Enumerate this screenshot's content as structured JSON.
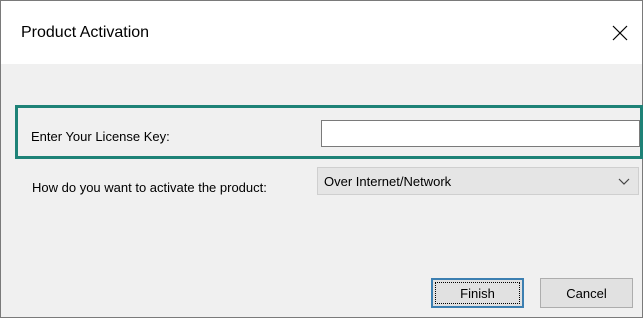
{
  "window": {
    "title": "Product Activation",
    "close_icon": "close-icon"
  },
  "form": {
    "license_label": "Enter Your License Key:",
    "license_value": "",
    "activation_label": "How do you want to activate the product:",
    "activation_selected": "Over Internet/Network",
    "activation_icon": "chevron-down-icon"
  },
  "buttons": {
    "finish_label": "Finish",
    "cancel_label": "Cancel"
  },
  "colors": {
    "highlight_border": "#1e8277",
    "default_button_border": "#3c7fb1",
    "background": "#f0f0f0"
  }
}
